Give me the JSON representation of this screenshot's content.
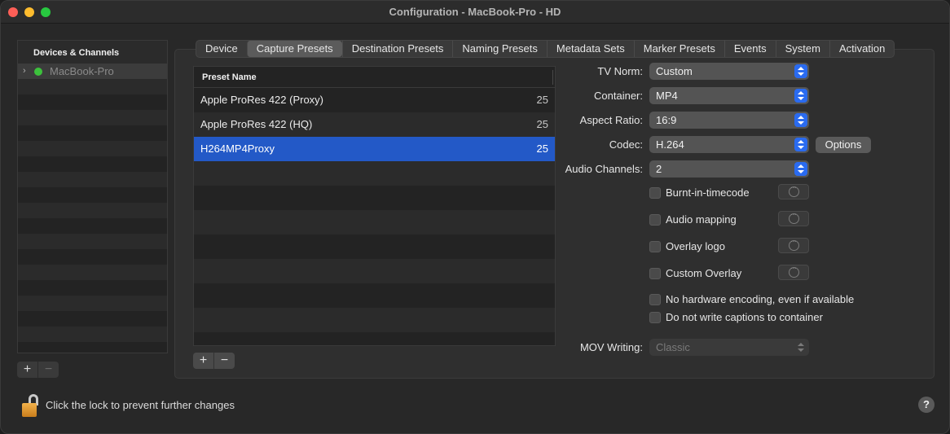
{
  "window": {
    "title": "Configuration - MacBook-Pro - HD"
  },
  "sidebar": {
    "header": "Devices & Channels",
    "devices": [
      {
        "label": "MacBook-Pro",
        "status_color": "#3cc13c"
      }
    ],
    "add_label": "+",
    "remove_label": "−"
  },
  "tabs": [
    {
      "label": "Device",
      "active": false
    },
    {
      "label": "Capture Presets",
      "active": true
    },
    {
      "label": "Destination Presets",
      "active": false
    },
    {
      "label": "Naming Presets",
      "active": false
    },
    {
      "label": "Metadata Sets",
      "active": false
    },
    {
      "label": "Marker Presets",
      "active": false
    },
    {
      "label": "Events",
      "active": false
    },
    {
      "label": "System",
      "active": false
    },
    {
      "label": "Activation",
      "active": false
    }
  ],
  "presets": {
    "column_header": "Preset Name",
    "rows": [
      {
        "name": "Apple ProRes 422 (Proxy)",
        "value": "25",
        "selected": false
      },
      {
        "name": "Apple ProRes 422 (HQ)",
        "value": "25",
        "selected": false
      },
      {
        "name": "H264MP4Proxy",
        "value": "25",
        "selected": true
      }
    ],
    "add_label": "+",
    "remove_label": "−"
  },
  "form": {
    "tv_norm": {
      "label": "TV Norm:",
      "value": "Custom"
    },
    "container": {
      "label": "Container:",
      "value": "MP4"
    },
    "aspect_ratio": {
      "label": "Aspect Ratio:",
      "value": "16:9"
    },
    "codec": {
      "label": "Codec:",
      "value": "H.264",
      "options_label": "Options"
    },
    "audio_channels": {
      "label": "Audio Channels:",
      "value": "2"
    },
    "checkboxes": [
      {
        "label": "Burnt-in-timecode",
        "checked": false
      },
      {
        "label": "Audio mapping",
        "checked": false
      },
      {
        "label": "Overlay logo",
        "checked": false
      },
      {
        "label": "Custom Overlay",
        "checked": false
      },
      {
        "label": "No hardware encoding, even if available",
        "checked": false
      },
      {
        "label": "Do not write captions to container",
        "checked": false
      }
    ],
    "mov_writing": {
      "label": "MOV Writing:",
      "value": "Classic"
    }
  },
  "footer": {
    "lock_text": "Click the lock to prevent further changes",
    "help_label": "?"
  },
  "colors": {
    "selection": "#2359c7",
    "accent": "#2a6bf0"
  }
}
